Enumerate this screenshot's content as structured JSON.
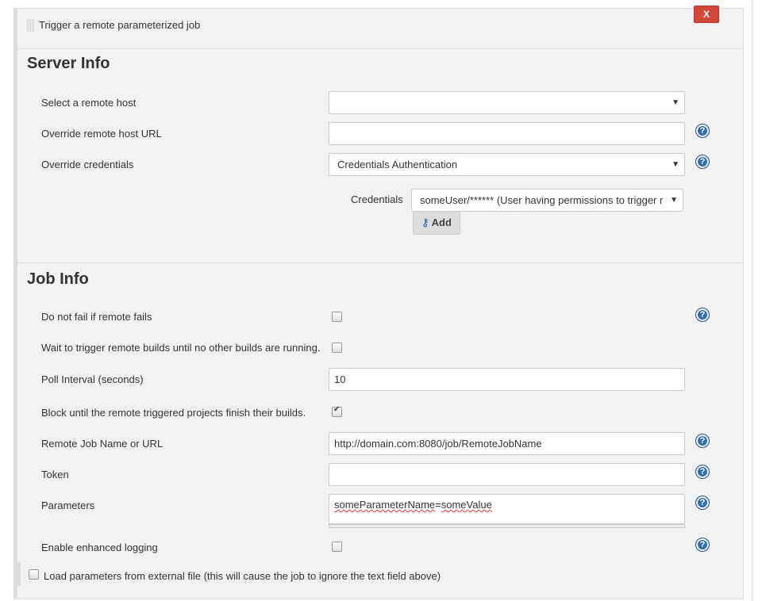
{
  "header": {
    "title": "Trigger a remote parameterized job",
    "close_label": "X"
  },
  "server_info": {
    "heading": "Server Info",
    "remote_host_label": "Select a remote host",
    "remote_host_value": "",
    "override_url_label": "Override remote host URL",
    "override_url_value": "",
    "override_credentials_label": "Override credentials",
    "override_credentials_value": "Credentials Authentication",
    "credentials_label": "Credentials",
    "credentials_value": "someUser/****** (User having permissions to trigger r",
    "add_label": "Add"
  },
  "job_info": {
    "heading": "Job Info",
    "do_not_fail_label": "Do not fail if remote fails",
    "do_not_fail_checked": false,
    "wait_label": "Wait to trigger remote builds until no other builds are running.",
    "wait_checked": false,
    "poll_label": "Poll Interval (seconds)",
    "poll_value": "10",
    "block_label": "Block until the remote triggered projects finish their builds.",
    "block_checked": true,
    "job_name_label": "Remote Job Name or URL",
    "job_name_value": "http://domain.com:8080/job/RemoteJobName",
    "token_label": "Token",
    "token_value": "",
    "parameters_label": "Parameters",
    "parameters_name": "someParameterName",
    "parameters_eq": "=",
    "parameters_value": "someValue",
    "logging_label": "Enable enhanced logging",
    "logging_checked": false,
    "load_file_label": "Load parameters from external file (this will cause the job to ignore the text field above)",
    "load_file_checked": false
  }
}
